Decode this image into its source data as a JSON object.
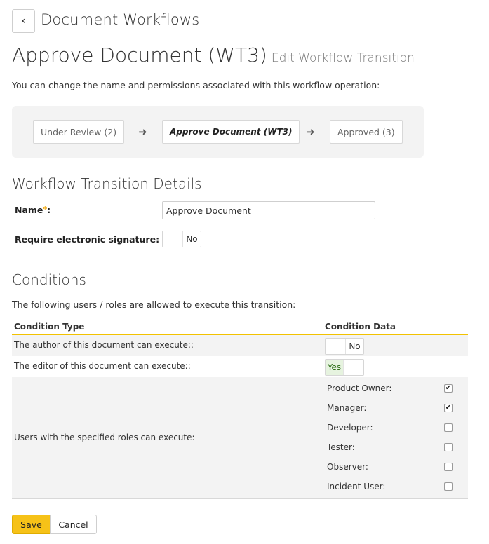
{
  "header": {
    "back_icon": "chevron-left-icon",
    "breadcrumb": "Document Workflows",
    "title": "Approve Document (WT3)",
    "subtitle": "Edit Workflow Transition",
    "intro": "You can change the name and permissions associated with this workflow operation:"
  },
  "flow": {
    "from": "Under Review (2)",
    "current": "Approve Document (WT3)",
    "to": "Approved (3)",
    "arrow_icon": "arrow-right-icon"
  },
  "details": {
    "title": "Workflow Transition Details",
    "name_label": "Name",
    "name_required": "*",
    "name_colon": ":",
    "name_value": "Approve Document",
    "signature_label": "Require electronic signature:",
    "signature_value": "No"
  },
  "conditions": {
    "title": "Conditions",
    "intro": "The following users / roles are allowed to execute this transition:",
    "col_type": "Condition Type",
    "col_data": "Condition Data",
    "author_label": "The author of this document can execute::",
    "author_value": "No",
    "editor_label": "The editor of this document can execute::",
    "editor_value": "Yes",
    "roles_label": "Users with the specified roles can execute:",
    "roles": [
      {
        "label": "Product Owner:",
        "checked": true
      },
      {
        "label": "Manager:",
        "checked": true
      },
      {
        "label": "Developer:",
        "checked": false
      },
      {
        "label": "Tester:",
        "checked": false
      },
      {
        "label": "Observer:",
        "checked": false
      },
      {
        "label": "Incident User:",
        "checked": false
      }
    ]
  },
  "actions": {
    "save": "Save",
    "cancel": "Cancel"
  },
  "colors": {
    "accent": "#f6c218",
    "toggle_on_bg": "#e6f3df",
    "panel_bg": "#f3f3f3"
  }
}
